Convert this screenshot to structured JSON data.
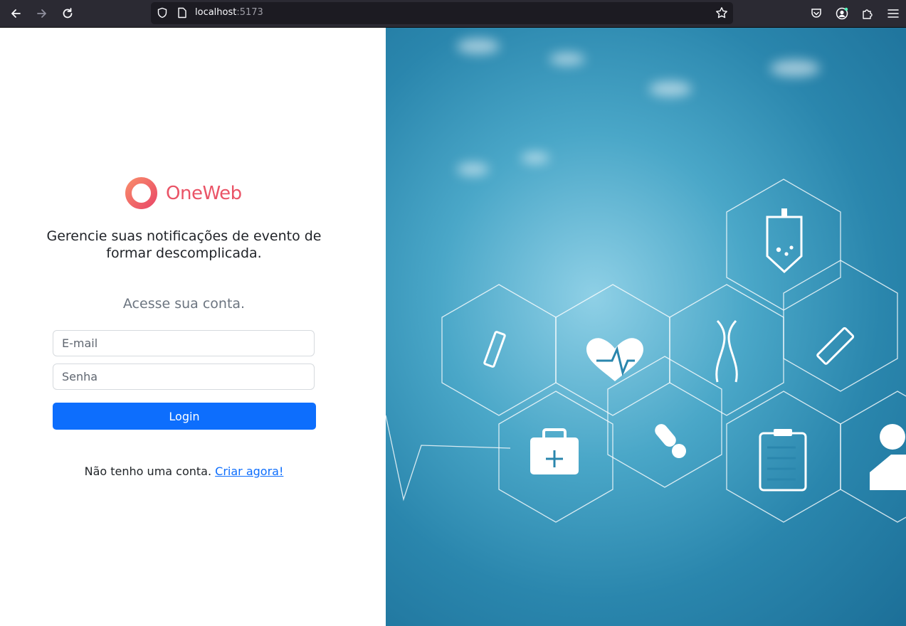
{
  "browser": {
    "url_host": "localhost",
    "url_port": ":5173",
    "icons": [
      "back-icon",
      "forward-icon",
      "reload-icon",
      "shield-icon",
      "page-icon",
      "star-icon",
      "pocket-icon",
      "account-icon",
      "extensions-icon",
      "menu-icon"
    ]
  },
  "brand": {
    "name": "OneWeb",
    "color": "#ea5467"
  },
  "tagline": "Gerencie suas notificações de evento de formar descomplicada.",
  "subtitle": "Acesse sua conta.",
  "form": {
    "email_placeholder": "E-mail",
    "password_placeholder": "Senha",
    "login_label": "Login"
  },
  "signup": {
    "text": "Não tenho uma conta.",
    "link_label": "Criar agora!"
  },
  "colors": {
    "primary": "#0d6efd",
    "hero_bg": "#2a86ad"
  }
}
